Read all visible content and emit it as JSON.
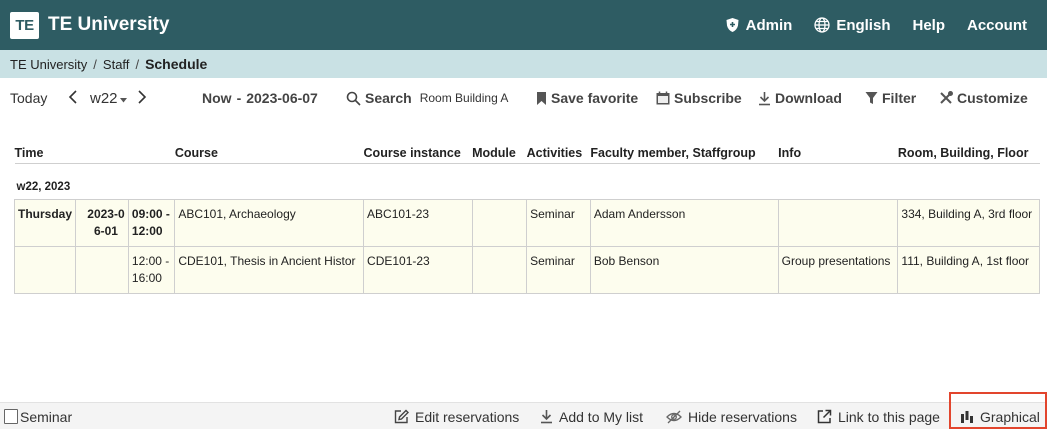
{
  "header": {
    "logo_text": "TE",
    "app_title": "TE University",
    "nav": {
      "admin": "Admin",
      "language": "English",
      "help": "Help",
      "account": "Account"
    }
  },
  "breadcrumb": {
    "items": [
      "TE University",
      "Staff"
    ],
    "separator": "/",
    "current": "Schedule"
  },
  "toolbar": {
    "today": "Today",
    "week": "w22",
    "now": "Now",
    "date_sep": "-",
    "date": "2023-06-07",
    "search_label": "Search",
    "search_value": "Room Building A",
    "save_favorite": "Save favorite",
    "subscribe": "Subscribe",
    "download": "Download",
    "filter": "Filter",
    "customize": "Customize"
  },
  "table": {
    "columns": [
      "Time",
      "Course",
      "Course instance",
      "Module",
      "Activities",
      "Faculty member, Staffgroup",
      "Info",
      "Room, Building, Floor"
    ],
    "week_label": "w22, 2023",
    "rows": [
      {
        "day": "Thursday",
        "date": "2023-06-01",
        "time": "09:00 - 12:00",
        "course": "ABC101, Archaeology",
        "course_instance": "ABC101-23",
        "module": "",
        "activities": "Seminar",
        "faculty": "Adam Andersson",
        "info": "",
        "room": "334, Building A, 3rd floor"
      },
      {
        "day": "",
        "date": "",
        "time": "12:00 - 16:00",
        "course": "CDE101, Thesis in Ancient Histor",
        "course_instance": "CDE101-23",
        "module": "",
        "activities": "Seminar",
        "faculty": "Bob Benson",
        "info": "Group presentations",
        "room": "111, Building A, 1st floor"
      }
    ]
  },
  "bottom": {
    "legend_label": "Seminar",
    "edit_reservations": "Edit reservations",
    "add_to_list": "Add to My list",
    "hide_reservations": "Hide reservations",
    "link_to_page": "Link to this page",
    "graphical": "Graphical"
  },
  "colors": {
    "header_bg": "#2e5c63",
    "breadcrumb_bg": "#c9e1e4",
    "row_bg": "#fdfdee",
    "highlight_border": "#e2452d"
  }
}
